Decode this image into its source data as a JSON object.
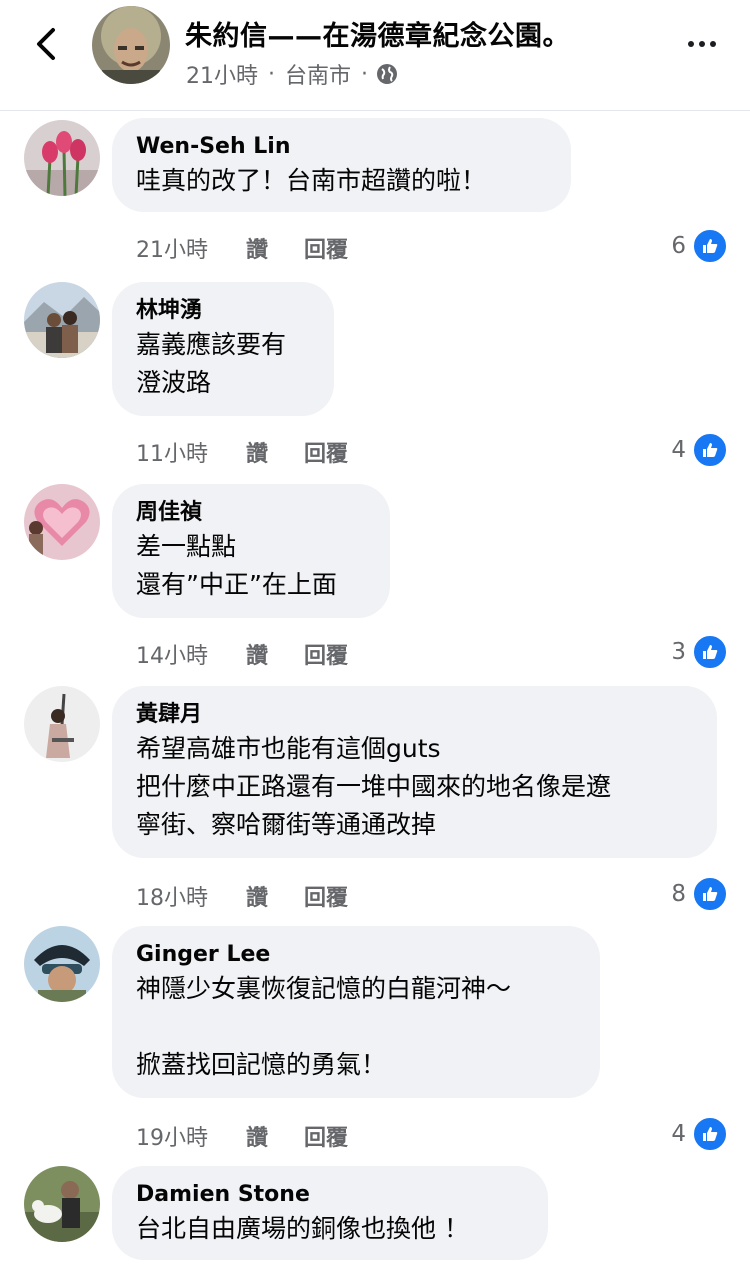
{
  "header": {
    "title": "朱約信——在湯德章紀念公園。",
    "time": "21小時",
    "location": "台南市",
    "separator": "·"
  },
  "comments": [
    {
      "author": "Wen-Seh Lin",
      "text": "哇真的改了！台南市超讚的啦！",
      "time": "21小時",
      "like_label": "讚",
      "reply_label": "回覆",
      "reaction_count": "6"
    },
    {
      "author": "林坤湧",
      "text": "嘉義應該要有\n澄波路",
      "time": "11小時",
      "like_label": "讚",
      "reply_label": "回覆",
      "reaction_count": "4"
    },
    {
      "author": "周佳禎",
      "text": "差一點點\n還有”中正”在上面",
      "time": "14小時",
      "like_label": "讚",
      "reply_label": "回覆",
      "reaction_count": "3"
    },
    {
      "author": "黃肆月",
      "text": "希望高雄市也能有這個guts\n把什麼中正路還有一堆中國來的地名像是遼\n寧街、察哈爾街等通通改掉",
      "time": "18小時",
      "like_label": "讚",
      "reply_label": "回覆",
      "reaction_count": "8"
    },
    {
      "author": "Ginger Lee",
      "text": "神隱少女裏恢復記憶的白龍河神～\n\n掀蓋找回記憶的勇氣！",
      "time": "19小時",
      "like_label": "讚",
      "reply_label": "回覆",
      "reaction_count": "4"
    },
    {
      "author": "Damien Stone",
      "text": "台北自由廣場的銅像也換他 ！"
    }
  ],
  "icons": {
    "back": "chevron-left-icon",
    "more": "more-dots-icon",
    "globe": "globe-icon",
    "like": "thumbs-up-icon"
  },
  "colors": {
    "accent": "#1877f2",
    "bubble": "#f0f2f5",
    "secondary_text": "#65676b"
  }
}
